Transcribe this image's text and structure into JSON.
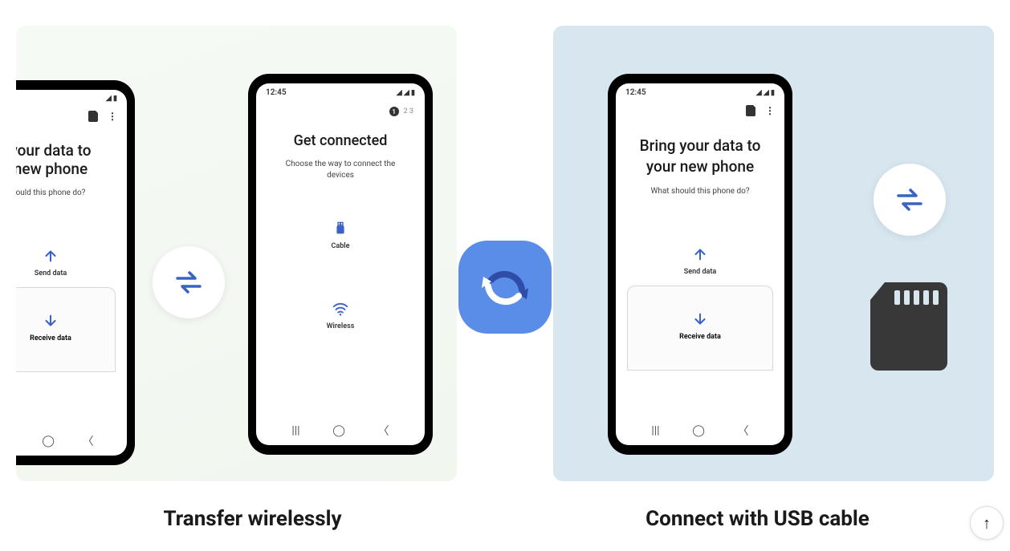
{
  "captions": {
    "left": "Transfer wirelessly",
    "right": "Connect with USB cable"
  },
  "phone_cut": {
    "title_line1": "your data to",
    "title_line2": "new phone",
    "sub": "ould this phone do?",
    "send": "Send data",
    "receive": "Receive data"
  },
  "phone_left": {
    "time": "12:45",
    "step": "1",
    "step_rest": "2  3",
    "title": "Get connected",
    "sub": "Choose the way to connect the devices",
    "opt_cable": "Cable",
    "opt_wireless": "Wireless"
  },
  "phone_right": {
    "time": "12:45",
    "title": "Bring your data to your new phone",
    "sub": "What should this phone do?",
    "send": "Send data",
    "receive": "Receive data"
  },
  "colors": {
    "accent": "#3a62c4",
    "app": "#5a8de8"
  }
}
